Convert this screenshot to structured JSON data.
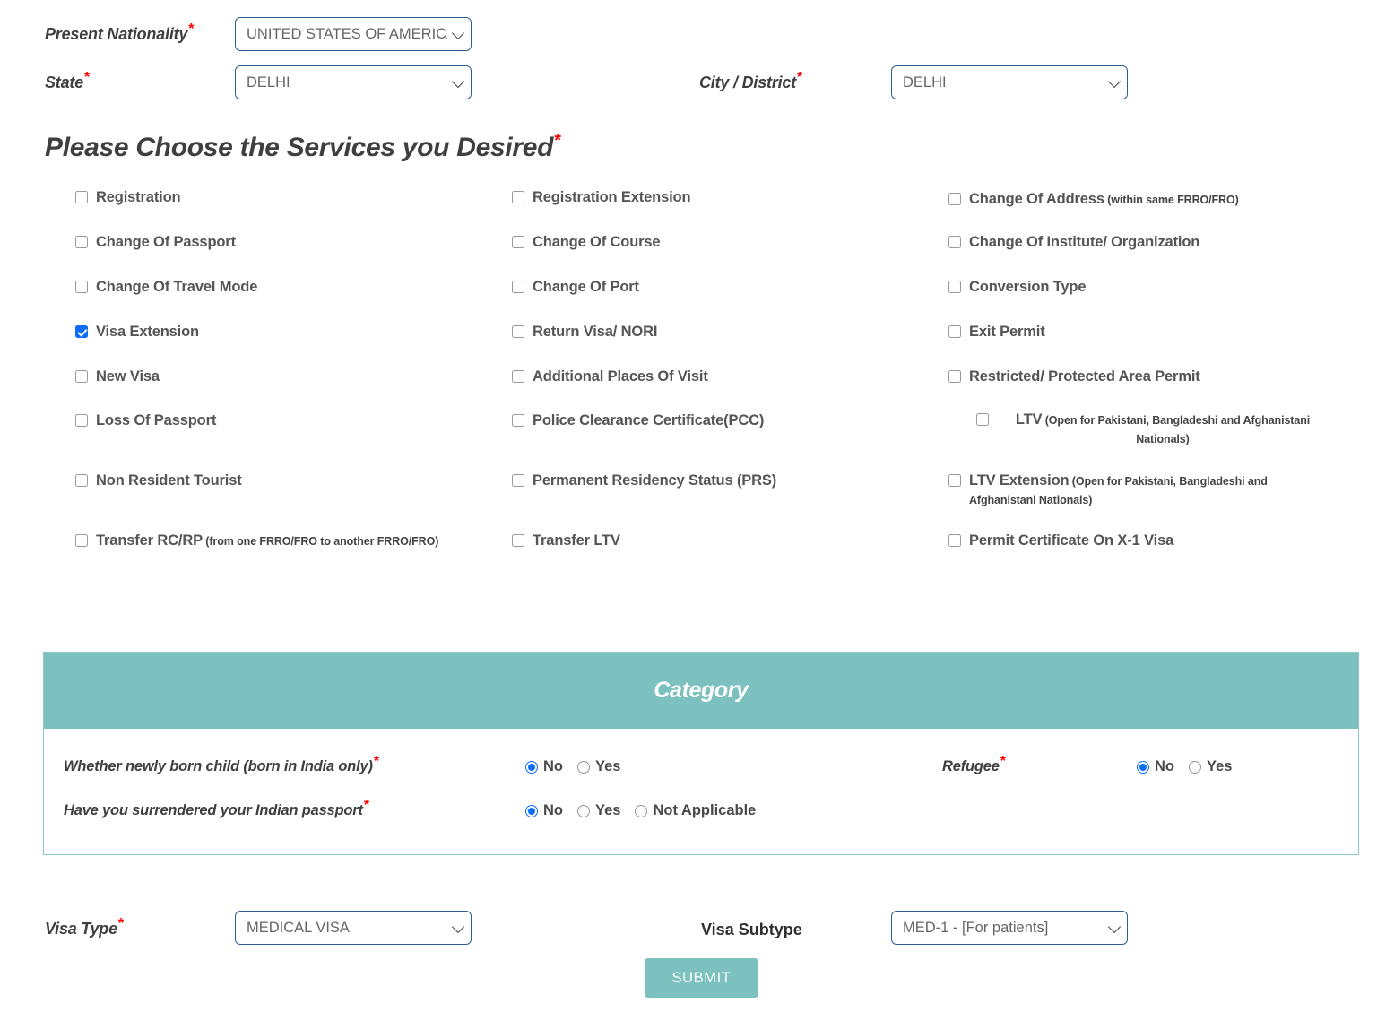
{
  "top_form": {
    "nationality": {
      "label": "Present Nationality",
      "required": "*",
      "value": "UNITED STATES OF AMERICA"
    },
    "state": {
      "label": "State",
      "required": "*",
      "value": "DELHI"
    },
    "city": {
      "label": "City / District",
      "required": "*",
      "value": "DELHI"
    }
  },
  "services": {
    "heading": "Please Choose the Services you Desired",
    "heading_required": "*",
    "columns": [
      {
        "items": [
          {
            "label": "Registration",
            "note": "",
            "checked": false
          },
          {
            "label": "Change Of Passport",
            "note": "",
            "checked": false
          },
          {
            "label": "Change Of Travel Mode",
            "note": "",
            "checked": false
          },
          {
            "label": "Visa Extension",
            "note": "",
            "checked": true
          },
          {
            "label": "New Visa",
            "note": "",
            "checked": false
          },
          {
            "label": "Loss Of Passport",
            "note": "",
            "checked": false
          },
          {
            "label": "Non Resident Tourist",
            "note": "",
            "checked": false
          },
          {
            "label": "Transfer RC/RP",
            "note": "(from one FRRO/FRO to another FRRO/FRO)",
            "checked": false
          }
        ]
      },
      {
        "items": [
          {
            "label": "Registration Extension",
            "note": "",
            "checked": false
          },
          {
            "label": "Change Of Course",
            "note": "",
            "checked": false
          },
          {
            "label": "Change Of Port",
            "note": "",
            "checked": false
          },
          {
            "label": "Return Visa/ NORI",
            "note": "",
            "checked": false
          },
          {
            "label": "Additional Places Of Visit",
            "note": "",
            "checked": false
          },
          {
            "label": "Police Clearance Certificate(PCC)",
            "note": "",
            "checked": false
          },
          {
            "label": "Permanent Residency Status (PRS)",
            "note": "",
            "checked": false
          },
          {
            "label": "Transfer LTV",
            "note": "",
            "checked": false
          }
        ]
      },
      {
        "items": [
          {
            "label": "Change Of Address",
            "note": "(within same FRRO/FRO)",
            "checked": false
          },
          {
            "label": "Change Of Institute/ Organization",
            "note": "",
            "checked": false
          },
          {
            "label": "Conversion Type",
            "note": "",
            "checked": false
          },
          {
            "label": "Exit Permit",
            "note": "",
            "checked": false
          },
          {
            "label": "Restricted/ Protected Area Permit",
            "note": "",
            "checked": false
          },
          {
            "label": "LTV",
            "note": "(Open for Pakistani, Bangladeshi and Afghanistani Nationals)",
            "checked": false
          },
          {
            "label": "LTV Extension",
            "note": "(Open for Pakistani, Bangladeshi and Afghanistani Nationals)",
            "checked": false
          },
          {
            "label": "Permit Certificate On X-1 Visa",
            "note": "",
            "checked": false
          }
        ]
      }
    ]
  },
  "category": {
    "title": "Category",
    "questions": [
      {
        "label": "Whether newly born child  (born in India only)",
        "required": "*",
        "options": [
          {
            "label": "No",
            "selected": true
          },
          {
            "label": "Yes",
            "selected": false
          }
        ]
      },
      {
        "label": "Have you surrendered your Indian passport",
        "required": "*",
        "options": [
          {
            "label": "No",
            "selected": true
          },
          {
            "label": "Yes",
            "selected": false
          },
          {
            "label": "Not Applicable",
            "selected": false
          }
        ]
      },
      {
        "label": "Refugee",
        "required": "*",
        "options": [
          {
            "label": "No",
            "selected": true
          },
          {
            "label": "Yes",
            "selected": false
          }
        ]
      }
    ]
  },
  "bottom_form": {
    "visa_type": {
      "label": "Visa Type",
      "required": "*",
      "value": "MEDICAL VISA"
    },
    "visa_subtype": {
      "label": "Visa Subtype",
      "required": "",
      "value": "MED-1 - [For patients]"
    },
    "submit_label": "SUBMIT"
  },
  "colors": {
    "teal": "#7cc0bf",
    "teal_border": "#8cc6c6",
    "select_border": "#2f5f91",
    "required_red": "#ff0000",
    "checkbox_blue": "#0d6efd"
  }
}
